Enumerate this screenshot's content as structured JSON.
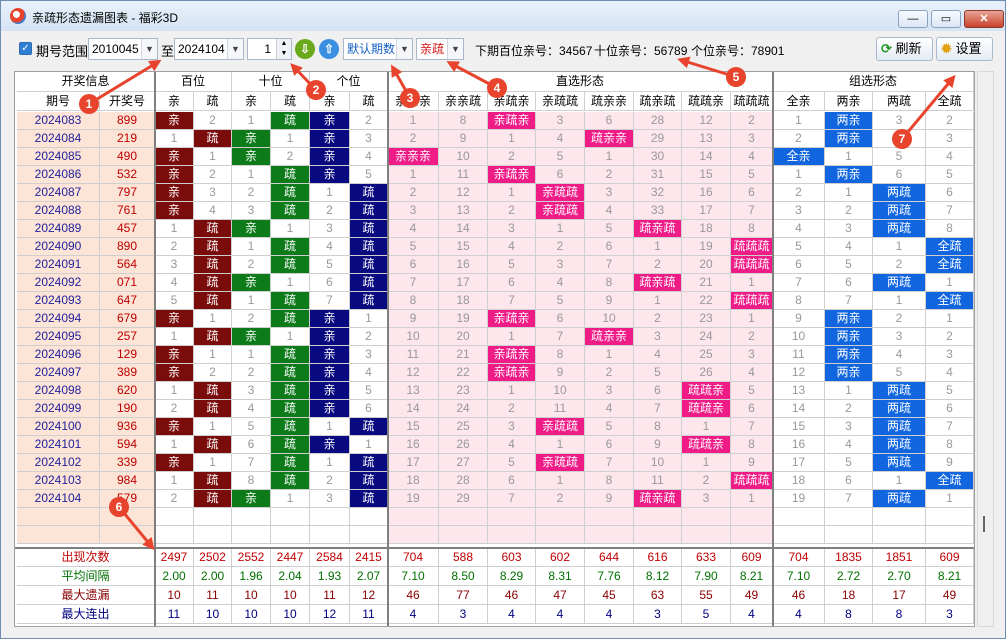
{
  "window": {
    "title": "亲疏形态遗漏图表 - 福彩3D"
  },
  "toolbar": {
    "range_label": "期号范围",
    "from": "2010045",
    "to_label": "至",
    "to": "2024104",
    "count": "1",
    "mode": "默认期数",
    "style": "亲疏",
    "next_hundreds": "下期百位亲号：34567",
    "next_tens": "十位亲号：56789",
    "next_units": "个位亲号：78901",
    "refresh": "刷新",
    "settings": "设置"
  },
  "header": {
    "groups": [
      "开奖信息",
      "百位",
      "十位",
      "个位",
      "直选形态",
      "组选形态"
    ],
    "columns": [
      "期号",
      "开奖号",
      "亲",
      "疏",
      "亲",
      "疏",
      "亲",
      "疏",
      "亲亲亲",
      "亲亲疏",
      "亲疏亲",
      "亲疏疏",
      "疏亲亲",
      "疏亲疏",
      "疏疏亲",
      "疏疏疏",
      "全亲",
      "两亲",
      "两疏",
      "全疏"
    ]
  },
  "annotations": [
    "1",
    "2",
    "3",
    "4",
    "5",
    "6",
    "7"
  ],
  "rows": [
    {
      "c": [
        "2024083",
        "899",
        "亲",
        "2",
        "1",
        "疏",
        "亲",
        "2",
        "1",
        "8",
        "亲疏亲",
        "3",
        "6",
        "28",
        "12",
        "2",
        "1",
        "两亲",
        "3",
        "2"
      ]
    },
    {
      "c": [
        "2024084",
        "219",
        "1",
        "疏",
        "亲",
        "1",
        "亲",
        "3",
        "2",
        "9",
        "1",
        "4",
        "疏亲亲",
        "29",
        "13",
        "3",
        "2",
        "两亲",
        "4",
        "3"
      ]
    },
    {
      "c": [
        "2024085",
        "490",
        "亲",
        "1",
        "亲",
        "2",
        "亲",
        "4",
        "亲亲亲",
        "10",
        "2",
        "5",
        "1",
        "30",
        "14",
        "4",
        "全亲",
        "1",
        "5",
        "4"
      ]
    },
    {
      "c": [
        "2024086",
        "532",
        "亲",
        "2",
        "1",
        "疏",
        "亲",
        "5",
        "1",
        "11",
        "亲疏亲",
        "6",
        "2",
        "31",
        "15",
        "5",
        "1",
        "两亲",
        "6",
        "5"
      ]
    },
    {
      "c": [
        "2024087",
        "797",
        "亲",
        "3",
        "2",
        "疏",
        "1",
        "疏",
        "2",
        "12",
        "1",
        "亲疏疏",
        "3",
        "32",
        "16",
        "6",
        "2",
        "1",
        "两疏",
        "6"
      ]
    },
    {
      "c": [
        "2024088",
        "761",
        "亲",
        "4",
        "3",
        "疏",
        "2",
        "疏",
        "3",
        "13",
        "2",
        "亲疏疏",
        "4",
        "33",
        "17",
        "7",
        "3",
        "2",
        "两疏",
        "7"
      ]
    },
    {
      "c": [
        "2024089",
        "457",
        "1",
        "疏",
        "亲",
        "1",
        "3",
        "疏",
        "4",
        "14",
        "3",
        "1",
        "5",
        "疏亲疏",
        "18",
        "8",
        "4",
        "3",
        "两疏",
        "8"
      ]
    },
    {
      "c": [
        "2024090",
        "890",
        "2",
        "疏",
        "1",
        "疏",
        "4",
        "疏",
        "5",
        "15",
        "4",
        "2",
        "6",
        "1",
        "19",
        "疏疏疏",
        "5",
        "4",
        "1",
        "全疏"
      ]
    },
    {
      "c": [
        "2024091",
        "564",
        "3",
        "疏",
        "2",
        "疏",
        "5",
        "疏",
        "6",
        "16",
        "5",
        "3",
        "7",
        "2",
        "20",
        "疏疏疏",
        "6",
        "5",
        "2",
        "全疏"
      ]
    },
    {
      "c": [
        "2024092",
        "071",
        "4",
        "疏",
        "亲",
        "1",
        "6",
        "疏",
        "7",
        "17",
        "6",
        "4",
        "8",
        "疏亲疏",
        "21",
        "1",
        "7",
        "6",
        "两疏",
        "1"
      ]
    },
    {
      "c": [
        "2024093",
        "647",
        "5",
        "疏",
        "1",
        "疏",
        "7",
        "疏",
        "8",
        "18",
        "7",
        "5",
        "9",
        "1",
        "22",
        "疏疏疏",
        "8",
        "7",
        "1",
        "全疏"
      ]
    },
    {
      "c": [
        "2024094",
        "679",
        "亲",
        "1",
        "2",
        "疏",
        "亲",
        "1",
        "9",
        "19",
        "亲疏亲",
        "6",
        "10",
        "2",
        "23",
        "1",
        "9",
        "两亲",
        "2",
        "1"
      ]
    },
    {
      "c": [
        "2024095",
        "257",
        "1",
        "疏",
        "亲",
        "1",
        "亲",
        "2",
        "10",
        "20",
        "1",
        "7",
        "疏亲亲",
        "3",
        "24",
        "2",
        "10",
        "两亲",
        "3",
        "2"
      ]
    },
    {
      "c": [
        "2024096",
        "129",
        "亲",
        "1",
        "1",
        "疏",
        "亲",
        "3",
        "11",
        "21",
        "亲疏亲",
        "8",
        "1",
        "4",
        "25",
        "3",
        "11",
        "两亲",
        "4",
        "3"
      ]
    },
    {
      "c": [
        "2024097",
        "389",
        "亲",
        "2",
        "2",
        "疏",
        "亲",
        "4",
        "12",
        "22",
        "亲疏亲",
        "9",
        "2",
        "5",
        "26",
        "4",
        "12",
        "两亲",
        "5",
        "4"
      ]
    },
    {
      "c": [
        "2024098",
        "620",
        "1",
        "疏",
        "3",
        "疏",
        "亲",
        "5",
        "13",
        "23",
        "1",
        "10",
        "3",
        "6",
        "疏疏亲",
        "5",
        "13",
        "1",
        "两疏",
        "5"
      ]
    },
    {
      "c": [
        "2024099",
        "190",
        "2",
        "疏",
        "4",
        "疏",
        "亲",
        "6",
        "14",
        "24",
        "2",
        "11",
        "4",
        "7",
        "疏疏亲",
        "6",
        "14",
        "2",
        "两疏",
        "6"
      ]
    },
    {
      "c": [
        "2024100",
        "936",
        "亲",
        "1",
        "5",
        "疏",
        "1",
        "疏",
        "15",
        "25",
        "3",
        "亲疏疏",
        "5",
        "8",
        "1",
        "7",
        "15",
        "3",
        "两疏",
        "7"
      ]
    },
    {
      "c": [
        "2024101",
        "594",
        "1",
        "疏",
        "6",
        "疏",
        "亲",
        "1",
        "16",
        "26",
        "4",
        "1",
        "6",
        "9",
        "疏疏亲",
        "8",
        "16",
        "4",
        "两疏",
        "8"
      ]
    },
    {
      "c": [
        "2024102",
        "339",
        "亲",
        "1",
        "7",
        "疏",
        "1",
        "疏",
        "17",
        "27",
        "5",
        "亲疏疏",
        "7",
        "10",
        "1",
        "9",
        "17",
        "5",
        "两疏",
        "9"
      ]
    },
    {
      "c": [
        "2024103",
        "984",
        "1",
        "疏",
        "8",
        "疏",
        "2",
        "疏",
        "18",
        "28",
        "6",
        "1",
        "8",
        "11",
        "2",
        "疏疏疏",
        "18",
        "6",
        "1",
        "全疏"
      ]
    },
    {
      "c": [
        "2024104",
        "579",
        "2",
        "疏",
        "亲",
        "1",
        "3",
        "疏",
        "19",
        "29",
        "7",
        "2",
        "9",
        "疏亲疏",
        "3",
        "1",
        "19",
        "7",
        "两疏",
        "1"
      ]
    }
  ],
  "stats": [
    {
      "label": "出现次数",
      "values": [
        "2497",
        "2502",
        "2552",
        "2447",
        "2584",
        "2415",
        "704",
        "588",
        "603",
        "602",
        "644",
        "616",
        "633",
        "609",
        "704",
        "1835",
        "1851",
        "609"
      ]
    },
    {
      "label": "平均间隔",
      "values": [
        "2.00",
        "2.00",
        "1.96",
        "2.04",
        "1.93",
        "2.07",
        "7.10",
        "8.50",
        "8.29",
        "8.31",
        "7.76",
        "8.12",
        "7.90",
        "8.21",
        "7.10",
        "2.72",
        "2.70",
        "8.21"
      ]
    },
    {
      "label": "最大遗漏",
      "values": [
        "10",
        "11",
        "10",
        "10",
        "11",
        "12",
        "46",
        "77",
        "46",
        "47",
        "45",
        "63",
        "55",
        "49",
        "46",
        "18",
        "17",
        "49"
      ]
    },
    {
      "label": "最大连出",
      "values": [
        "11",
        "10",
        "10",
        "10",
        "12",
        "11",
        "4",
        "3",
        "4",
        "4",
        "4",
        "3",
        "5",
        "4",
        "4",
        "8",
        "8",
        "3"
      ]
    }
  ],
  "colors": {
    "hundreds_hit": "#7b0c0c",
    "tens_hit": "#0e7b1a",
    "units_hit": "#0a0a80",
    "direct_hit": "#ef1b87",
    "group_hit": "#1166e0",
    "annotation": "#e8432c"
  }
}
